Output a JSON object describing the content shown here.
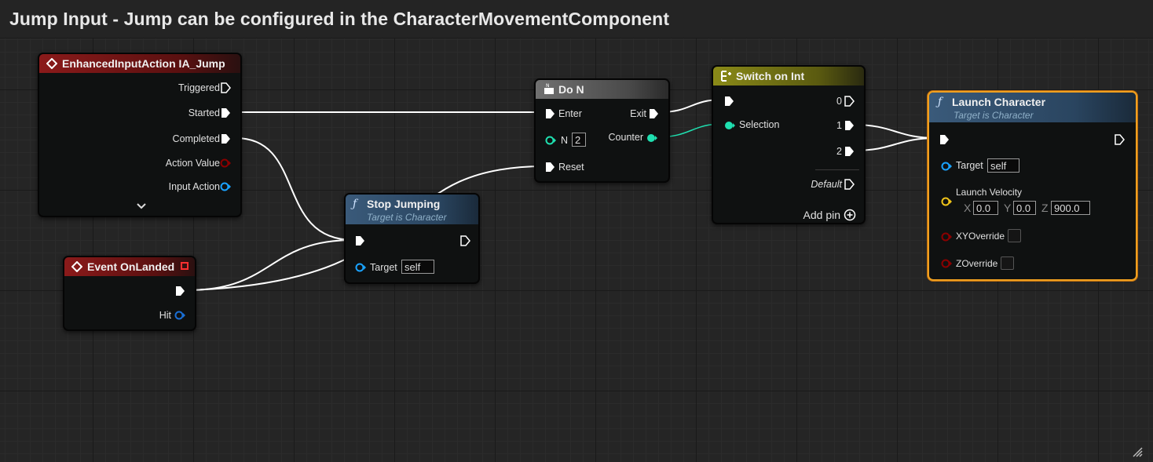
{
  "comment": {
    "title": "Jump Input - Jump can be configured in the CharacterMovementComponent"
  },
  "colors": {
    "exec": "#ffffff",
    "object": "#1aa3ff",
    "vector": "#f0c419",
    "bool": "#8b0000",
    "int": "#1fe0b0",
    "event_header": "#8b1a1a",
    "function_header": "#3a5a7a",
    "macro_header": "#6e6e6e",
    "switch_header": "#7a7a12",
    "selected": "#f0a020"
  },
  "nodes": {
    "enhanced_input": {
      "title": "EnhancedInputAction IA_Jump",
      "pins": {
        "triggered": "Triggered",
        "started": "Started",
        "completed": "Completed",
        "action_value": "Action Value",
        "input_action": "Input Action"
      }
    },
    "event_onlanded": {
      "title": "Event OnLanded",
      "pins": {
        "hit": "Hit"
      }
    },
    "stop_jumping": {
      "title": "Stop Jumping",
      "subtitle": "Target is Character",
      "pins": {
        "target": "Target",
        "target_value": "self"
      }
    },
    "do_n": {
      "title": "Do N",
      "pins": {
        "enter": "Enter",
        "exit": "Exit",
        "n": "N",
        "n_value": "2",
        "counter": "Counter",
        "reset": "Reset"
      }
    },
    "switch_on_int": {
      "title": "Switch on Int",
      "pins": {
        "selection": "Selection",
        "out0": "0",
        "out1": "1",
        "out2": "2",
        "default": "Default",
        "add_pin": "Add pin"
      }
    },
    "launch_character": {
      "title": "Launch Character",
      "subtitle": "Target is Character",
      "pins": {
        "target": "Target",
        "target_value": "self",
        "launch_velocity": "Launch Velocity",
        "x_label": "X",
        "x_value": "0.0",
        "y_label": "Y",
        "y_value": "0.0",
        "z_label": "Z",
        "z_value": "900.0",
        "xy_override": "XYOverride",
        "z_override": "ZOverride"
      }
    }
  }
}
